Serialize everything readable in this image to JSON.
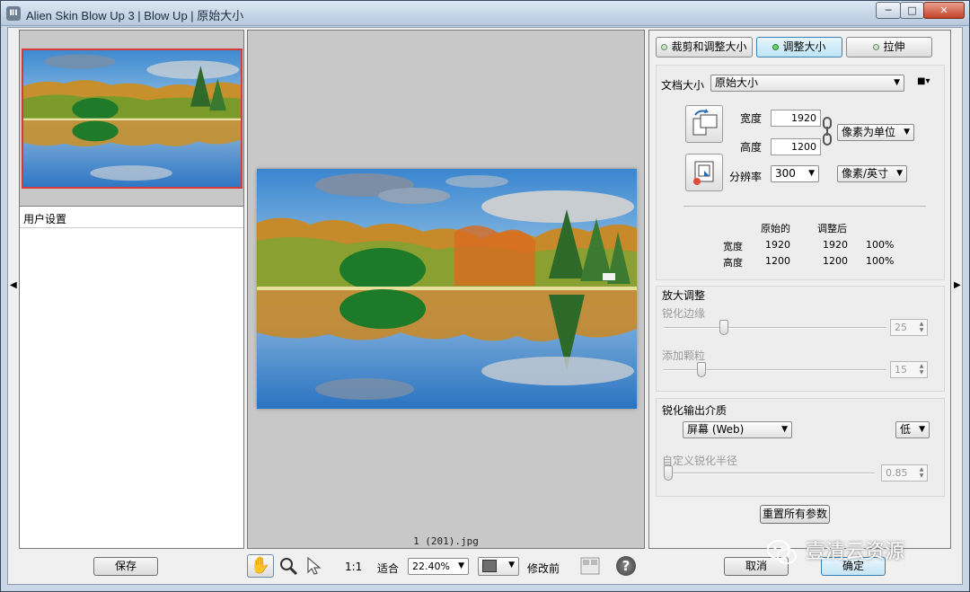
{
  "window": {
    "title": "Alien Skin Blow Up 3 | Blow Up | 原始大小",
    "icon_label": "ⅡI",
    "controls": {
      "minimize": "─",
      "maximize": "□",
      "close": "✕"
    }
  },
  "left_panel": {
    "user_settings_label": "用户设置",
    "save_button": "保存"
  },
  "preview": {
    "filename": "1 (201).jpg"
  },
  "tabs": [
    {
      "label": "裁剪和调整大小",
      "active": false
    },
    {
      "label": "调整大小",
      "active": true
    },
    {
      "label": "拉伸",
      "active": false
    }
  ],
  "document_size": {
    "label": "文档大小",
    "value": "原始大小",
    "menu_icon": "■▾"
  },
  "dimensions": {
    "width_label": "宽度",
    "width_value": "1920",
    "height_label": "高度",
    "height_value": "1200",
    "unit_value": "像素为单位",
    "resolution_label": "分辨率",
    "resolution_value": "300",
    "resolution_unit": "像素/英寸"
  },
  "comparison": {
    "col_original": "原始的",
    "col_adjusted": "调整后",
    "rows": [
      {
        "label": "宽度",
        "original": "1920",
        "adjusted": "1920",
        "percent": "100%"
      },
      {
        "label": "高度",
        "original": "1200",
        "adjusted": "1200",
        "percent": "100%"
      }
    ]
  },
  "enlarge": {
    "title": "放大调整",
    "sharpen_edges_label": "锐化边缘",
    "sharpen_edges_value": "25",
    "sharpen_edges_level": 0.25,
    "add_grain_label": "添加颗粒",
    "add_grain_value": "15",
    "add_grain_level": 0.15
  },
  "output_sharpen": {
    "title": "锐化输出介质",
    "medium_value": "屏幕 (Web)",
    "level_value": "低",
    "custom_radius_label": "自定义锐化半径",
    "custom_radius_value": "0.85"
  },
  "reset_button": "重置所有参数",
  "footer": {
    "cancel_button": "取消",
    "ok_button": "确定",
    "zoom_1to1": "1:1",
    "fit_label": "适合",
    "zoom_value": "22.40%",
    "before_label": "修改前",
    "help_icon": "?"
  },
  "watermark": "壹清云资源",
  "colors": {
    "accent": "#3c7fb1",
    "nav_frame": "#d83a3a",
    "sky": "#3f8ad0"
  }
}
